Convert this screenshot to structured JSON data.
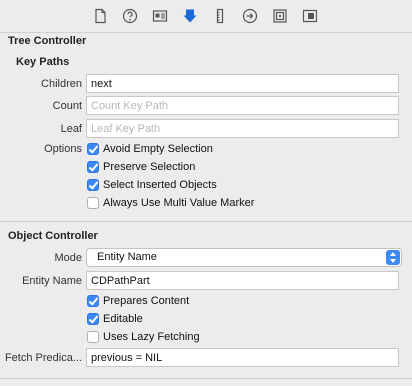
{
  "toolbar": {
    "tabs": [
      {
        "icon": "file-inspector-icon"
      },
      {
        "icon": "quick-help-icon"
      },
      {
        "icon": "identity-inspector-icon"
      },
      {
        "icon": "attributes-inspector-icon",
        "active": true,
        "color": "#1b6bd6"
      },
      {
        "icon": "size-inspector-icon"
      },
      {
        "icon": "connections-inspector-icon"
      },
      {
        "icon": "bindings-inspector-icon"
      },
      {
        "icon": "view-effects-inspector-icon"
      }
    ]
  },
  "tree_controller": {
    "title": "Tree Controller",
    "key_paths_title": "Key Paths",
    "children_label": "Children",
    "children_value": "next",
    "count_label": "Count",
    "count_placeholder": "Count Key Path",
    "leaf_label": "Leaf",
    "leaf_placeholder": "Leaf Key Path",
    "options_label": "Options",
    "options": [
      {
        "label": "Avoid Empty Selection",
        "checked": true
      },
      {
        "label": "Preserve Selection",
        "checked": true
      },
      {
        "label": "Select Inserted Objects",
        "checked": true
      },
      {
        "label": "Always Use Multi Value Marker",
        "checked": false
      }
    ]
  },
  "object_controller": {
    "title": "Object Controller",
    "mode_label": "Mode",
    "mode_value": "Entity Name",
    "entity_label": "Entity Name",
    "entity_value": "CDPathPart",
    "options": [
      {
        "label": "Prepares Content",
        "checked": true
      },
      {
        "label": "Editable",
        "checked": true
      },
      {
        "label": "Uses Lazy Fetching",
        "checked": false
      }
    ],
    "fetch_label": "Fetch Predica...",
    "fetch_value": "previous = NIL"
  },
  "colors": {
    "accent": "#3d88f5",
    "active_tab": "#1b6bd6"
  }
}
